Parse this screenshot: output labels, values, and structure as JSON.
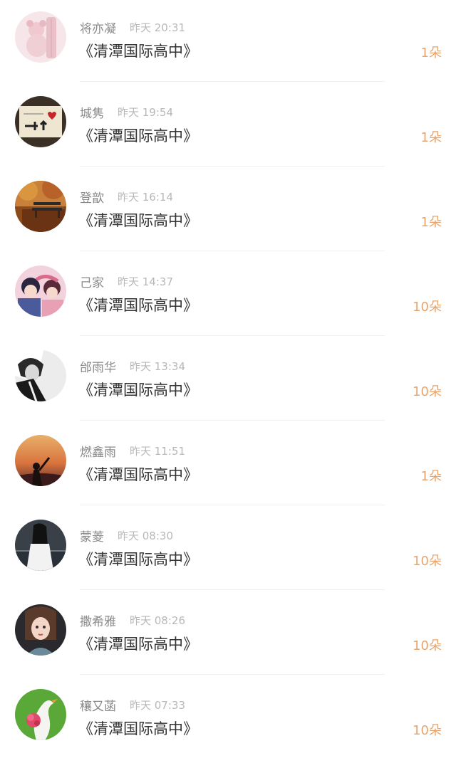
{
  "gifts": [
    {
      "user": "将亦凝",
      "time": "昨天 20:31",
      "book": "《清潭国际高中》",
      "count": "1朵",
      "avatar_icon": "teddy-bear-avatar-icon"
    },
    {
      "user": "城隽",
      "time": "昨天 19:54",
      "book": "《清潭国际高中》",
      "count": "1朵",
      "avatar_icon": "handwritten-card-avatar-icon"
    },
    {
      "user": "登歆",
      "time": "昨天 16:14",
      "book": "《清潭国际高中》",
      "count": "1朵",
      "avatar_icon": "autumn-bench-avatar-icon"
    },
    {
      "user": "己家",
      "time": "昨天 14:37",
      "book": "《清潭国际高中》",
      "count": "10朵",
      "avatar_icon": "anime-couple-avatar-icon"
    },
    {
      "user": "邰雨华",
      "time": "昨天 13:34",
      "book": "《清潭国际高中》",
      "count": "10朵",
      "avatar_icon": "monochrome-portrait-avatar-icon"
    },
    {
      "user": "燃鑫雨",
      "time": "昨天 11:51",
      "book": "《清潭国际高中》",
      "count": "1朵",
      "avatar_icon": "sunset-silhouette-avatar-icon"
    },
    {
      "user": "蒙菱",
      "time": "昨天 08:30",
      "book": "《清潭国际高中》",
      "count": "10朵",
      "avatar_icon": "girl-by-sea-avatar-icon"
    },
    {
      "user": "撒希雅",
      "time": "昨天 08:26",
      "book": "《清潭国际高中》",
      "count": "10朵",
      "avatar_icon": "illustrated-girl-avatar-icon"
    },
    {
      "user": "穰又菡",
      "time": "昨天 07:33",
      "book": "《清潭国际高中》",
      "count": "10朵",
      "avatar_icon": "swan-flower-avatar-icon"
    }
  ],
  "colors": {
    "count": "#e8a46a",
    "name": "#8a8a8a",
    "time": "#b8b8b8",
    "book": "#333333"
  }
}
